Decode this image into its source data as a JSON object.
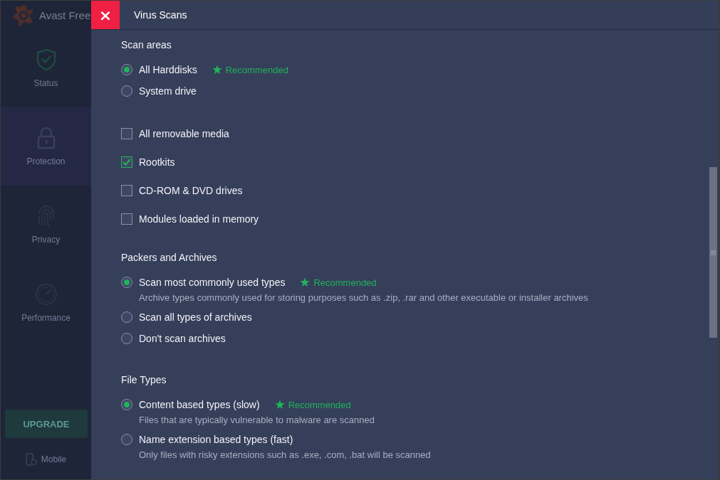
{
  "sidebar": {
    "app_title": "Avast Free",
    "items": [
      {
        "label": "Status",
        "selected": false
      },
      {
        "label": "Protection",
        "selected": true
      },
      {
        "label": "Privacy",
        "selected": false
      },
      {
        "label": "Performance",
        "selected": false
      }
    ],
    "upgrade_button": "UPGRADE",
    "mobile_link": "Mobile"
  },
  "panel": {
    "close_button": "×",
    "title": "Virus Scans",
    "sections": [
      {
        "heading": "Scan areas",
        "options": [
          {
            "kind": "radio",
            "label": "All Harddisks",
            "selected": true,
            "badge": "Recommended"
          },
          {
            "kind": "radio",
            "label": "System drive",
            "selected": false
          }
        ]
      },
      {
        "options": [
          {
            "kind": "checkbox",
            "label": "All removable media",
            "checked": false
          },
          {
            "kind": "checkbox",
            "label": "Rootkits",
            "checked": true
          },
          {
            "kind": "checkbox",
            "label": "CD-ROM & DVD drives",
            "checked": false
          },
          {
            "kind": "checkbox",
            "label": "Modules loaded in memory",
            "checked": false
          }
        ]
      },
      {
        "heading": "Packers and Archives",
        "options": [
          {
            "kind": "radio",
            "label": "Scan most commonly used types",
            "selected": true,
            "badge": "Recommended",
            "description": "Archive types commonly used for storing purposes such as .zip, .rar and other executable or installer archives"
          },
          {
            "kind": "radio",
            "label": "Scan all types of archives",
            "selected": false
          },
          {
            "kind": "radio",
            "label": "Don't scan archives",
            "selected": false
          }
        ]
      },
      {
        "heading": "File Types",
        "options": [
          {
            "kind": "radio",
            "label": "Content based types (slow)",
            "selected": true,
            "badge": "Recommended",
            "description": "Files that are typically vulnerable to malware are scanned"
          },
          {
            "kind": "radio",
            "label": "Name extension based types (fast)",
            "selected": false,
            "description": "Only files with risky extensions such as .exe, .com, .bat will be scanned"
          }
        ]
      }
    ]
  }
}
